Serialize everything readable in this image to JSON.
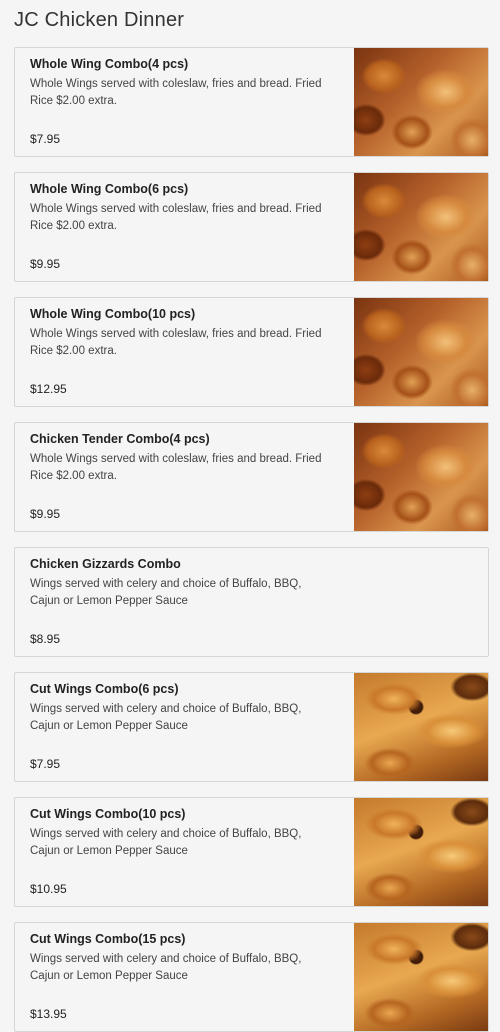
{
  "section": {
    "title": "JC Chicken Dinner"
  },
  "items": [
    {
      "name": "Whole Wing Combo(4 pcs)",
      "description": "Whole Wings served with coleslaw, fries and bread. Fried Rice $2.00 extra.",
      "price": "$7.95",
      "photo": "fried-chicken-wings-photo"
    },
    {
      "name": "Whole Wing Combo(6 pcs)",
      "description": "Whole Wings served with coleslaw, fries and bread. Fried Rice $2.00 extra.",
      "price": "$9.95",
      "photo": "fried-chicken-wings-photo"
    },
    {
      "name": "Whole Wing Combo(10 pcs)",
      "description": "Whole Wings served with coleslaw, fries and bread. Fried Rice $2.00 extra.",
      "price": "$12.95",
      "photo": "fried-chicken-wings-photo"
    },
    {
      "name": "Chicken Tender Combo(4 pcs)",
      "description": "Whole Wings served with coleslaw, fries and bread. Fried Rice $2.00 extra.",
      "price": "$9.95",
      "photo": "fried-chicken-wings-photo"
    },
    {
      "name": "Chicken Gizzards Combo",
      "description": "Wings served with celery and choice of Buffalo, BBQ, Cajun or Lemon Pepper Sauce",
      "price": "$8.95",
      "photo": null
    },
    {
      "name": "Cut Wings Combo(6 pcs)",
      "description": "Wings served with celery and choice of Buffalo, BBQ, Cajun or Lemon Pepper Sauce",
      "price": "$7.95",
      "photo": "cut-wings-photo"
    },
    {
      "name": "Cut Wings Combo(10 pcs)",
      "description": "Wings served with celery and choice of Buffalo, BBQ, Cajun or Lemon Pepper Sauce",
      "price": "$10.95",
      "photo": "cut-wings-photo"
    },
    {
      "name": "Cut Wings Combo(15 pcs)",
      "description": "Wings served with celery and choice of Buffalo, BBQ, Cajun or Lemon Pepper Sauce",
      "price": "$13.95",
      "photo": "cut-wings-photo"
    }
  ]
}
